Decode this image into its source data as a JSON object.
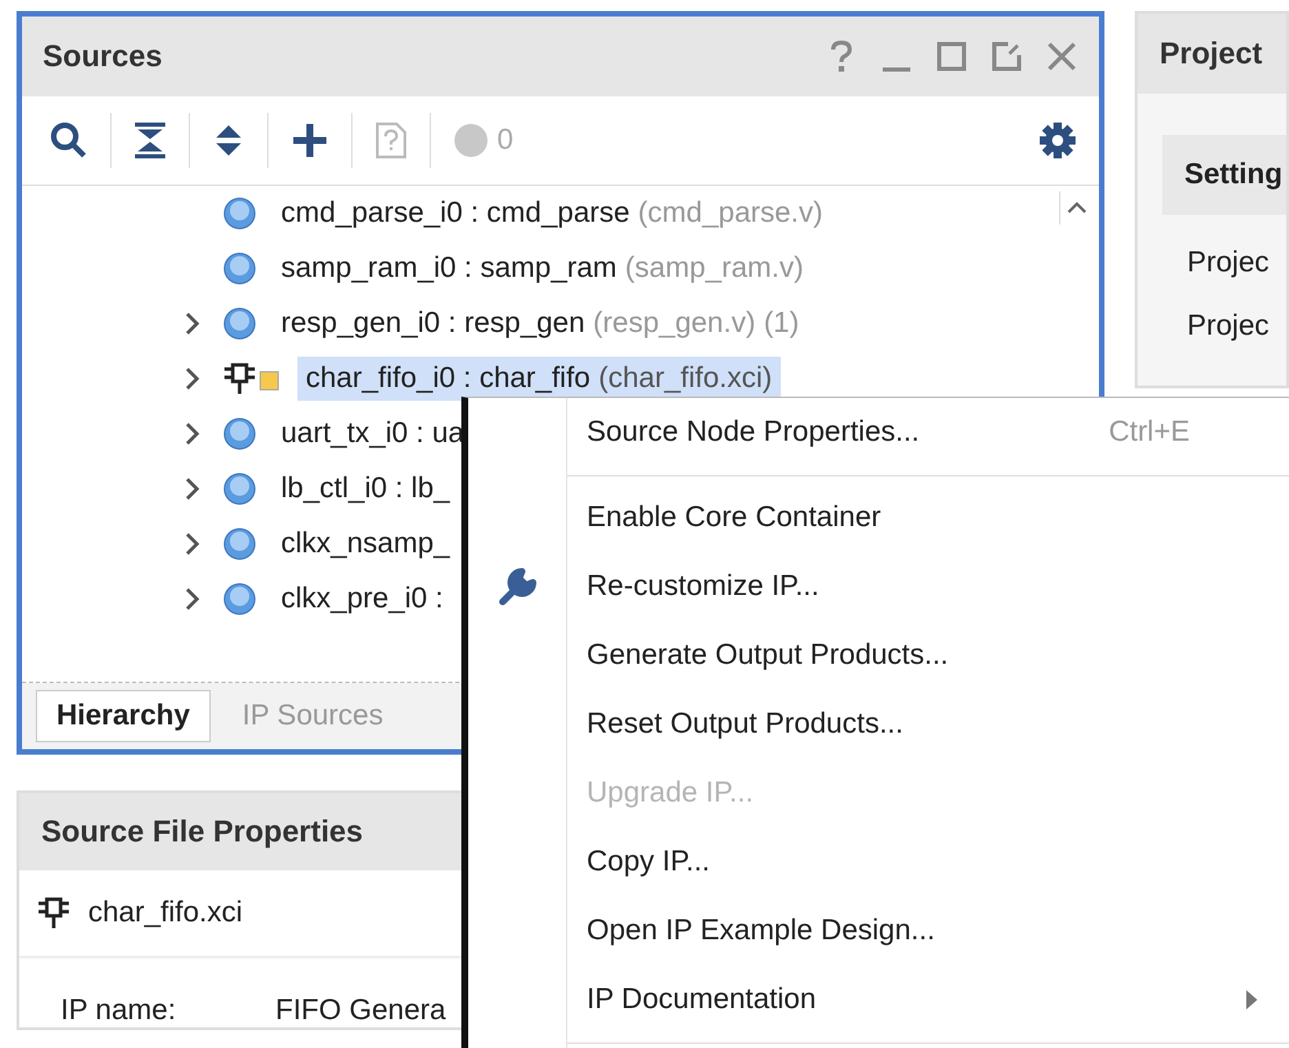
{
  "sources": {
    "title": "Sources",
    "warning_count": "0",
    "tree": [
      {
        "kind": "verilog",
        "expandable": false,
        "selected": false,
        "name": "cmd_parse_i0 : cmd_parse",
        "file": "(cmd_parse.v)"
      },
      {
        "kind": "verilog",
        "expandable": false,
        "selected": false,
        "name": "samp_ram_i0 : samp_ram",
        "file": "(samp_ram.v)"
      },
      {
        "kind": "verilog",
        "expandable": true,
        "selected": false,
        "name": "resp_gen_i0 : resp_gen",
        "file": "(resp_gen.v)",
        "count": "(1)"
      },
      {
        "kind": "ip",
        "expandable": true,
        "selected": true,
        "name": "char_fifo_i0 : char_fifo",
        "file": "(char_fifo.xci)"
      },
      {
        "kind": "verilog",
        "expandable": true,
        "selected": false,
        "name": "uart_tx_i0 : ua"
      },
      {
        "kind": "verilog",
        "expandable": true,
        "selected": false,
        "name": "lb_ctl_i0 : lb_"
      },
      {
        "kind": "verilog",
        "expandable": true,
        "selected": false,
        "name": "clkx_nsamp_"
      },
      {
        "kind": "verilog",
        "expandable": true,
        "selected": false,
        "name": "clkx_pre_i0 :"
      }
    ],
    "tabs": [
      {
        "label": "Hierarchy",
        "selected": true
      },
      {
        "label": "IP Sources",
        "selected": false
      }
    ]
  },
  "project": {
    "title": "Project",
    "section": "Setting",
    "rows": [
      "Projec",
      "Projec"
    ]
  },
  "properties": {
    "title": "Source File Properties",
    "file": "char_fifo.xci",
    "fields": [
      {
        "label": "IP name:",
        "value": "FIFO Genera"
      }
    ]
  },
  "context_menu": {
    "items": [
      {
        "kind": "plain",
        "label": "Source Node Properties...",
        "shortcut": "Ctrl+E",
        "disabled": false,
        "submenu": false,
        "separator_after": true
      },
      {
        "kind": "plain",
        "label": "Enable Core Container",
        "disabled": false,
        "submenu": false,
        "separator_after": false
      },
      {
        "kind": "tool",
        "label": "Re-customize IP...",
        "disabled": false,
        "submenu": false,
        "separator_after": false
      },
      {
        "kind": "plain",
        "label": "Generate Output Products...",
        "disabled": false,
        "submenu": false,
        "separator_after": false
      },
      {
        "kind": "plain",
        "label": "Reset Output Products...",
        "disabled": false,
        "submenu": false,
        "separator_after": false
      },
      {
        "kind": "plain",
        "label": "Upgrade IP...",
        "disabled": true,
        "submenu": false,
        "separator_after": false
      },
      {
        "kind": "plain",
        "label": "Copy IP...",
        "disabled": false,
        "submenu": false,
        "separator_after": false
      },
      {
        "kind": "plain",
        "label": "Open IP Example Design...",
        "disabled": false,
        "submenu": false,
        "separator_after": false
      },
      {
        "kind": "plain",
        "label": "IP Documentation",
        "disabled": false,
        "submenu": true,
        "separator_after": true
      }
    ]
  }
}
